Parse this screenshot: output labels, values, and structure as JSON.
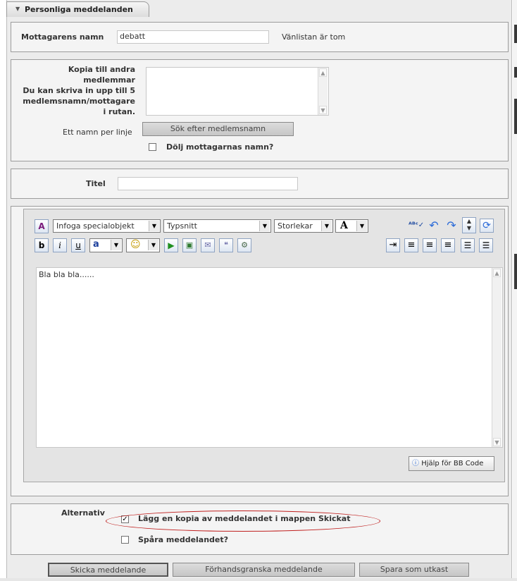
{
  "tab": {
    "title": "Personliga meddelanden"
  },
  "recipient": {
    "label": "Mottagarens namn",
    "value": "debatt",
    "buddy_note": "Vänlistan är tom"
  },
  "cc": {
    "label_lines": [
      "Kopia till andra",
      "medlemmar",
      "Du kan skriva in upp till 5",
      "medlemsnamn/mottagare",
      "i rutan."
    ],
    "per_line_label": "Ett namn per linje",
    "search_button": "Sök efter medlemsnamn",
    "hide_label": "Dölj mottagarnas namn?"
  },
  "title_field": {
    "label": "Titel",
    "value": ""
  },
  "editor": {
    "insert_select": "Infoga specialobjekt",
    "font_select": "Typsnitt",
    "size_select": "Storlekar",
    "text": "Bla bla bla......",
    "help_button": "Hjälp för BB Code"
  },
  "options": {
    "label": "Alternativ",
    "save_copy_label": "Lägg en kopia av meddelandet i mappen Skickat",
    "save_copy_checked": true,
    "track_label": "Spåra meddelandet?",
    "track_checked": false
  },
  "buttons": {
    "send": "Skicka meddelande",
    "preview": "Förhandsgranska meddelande",
    "draft": "Spara som utkast"
  },
  "colors": {
    "highlight_ring": "#c0201f"
  }
}
